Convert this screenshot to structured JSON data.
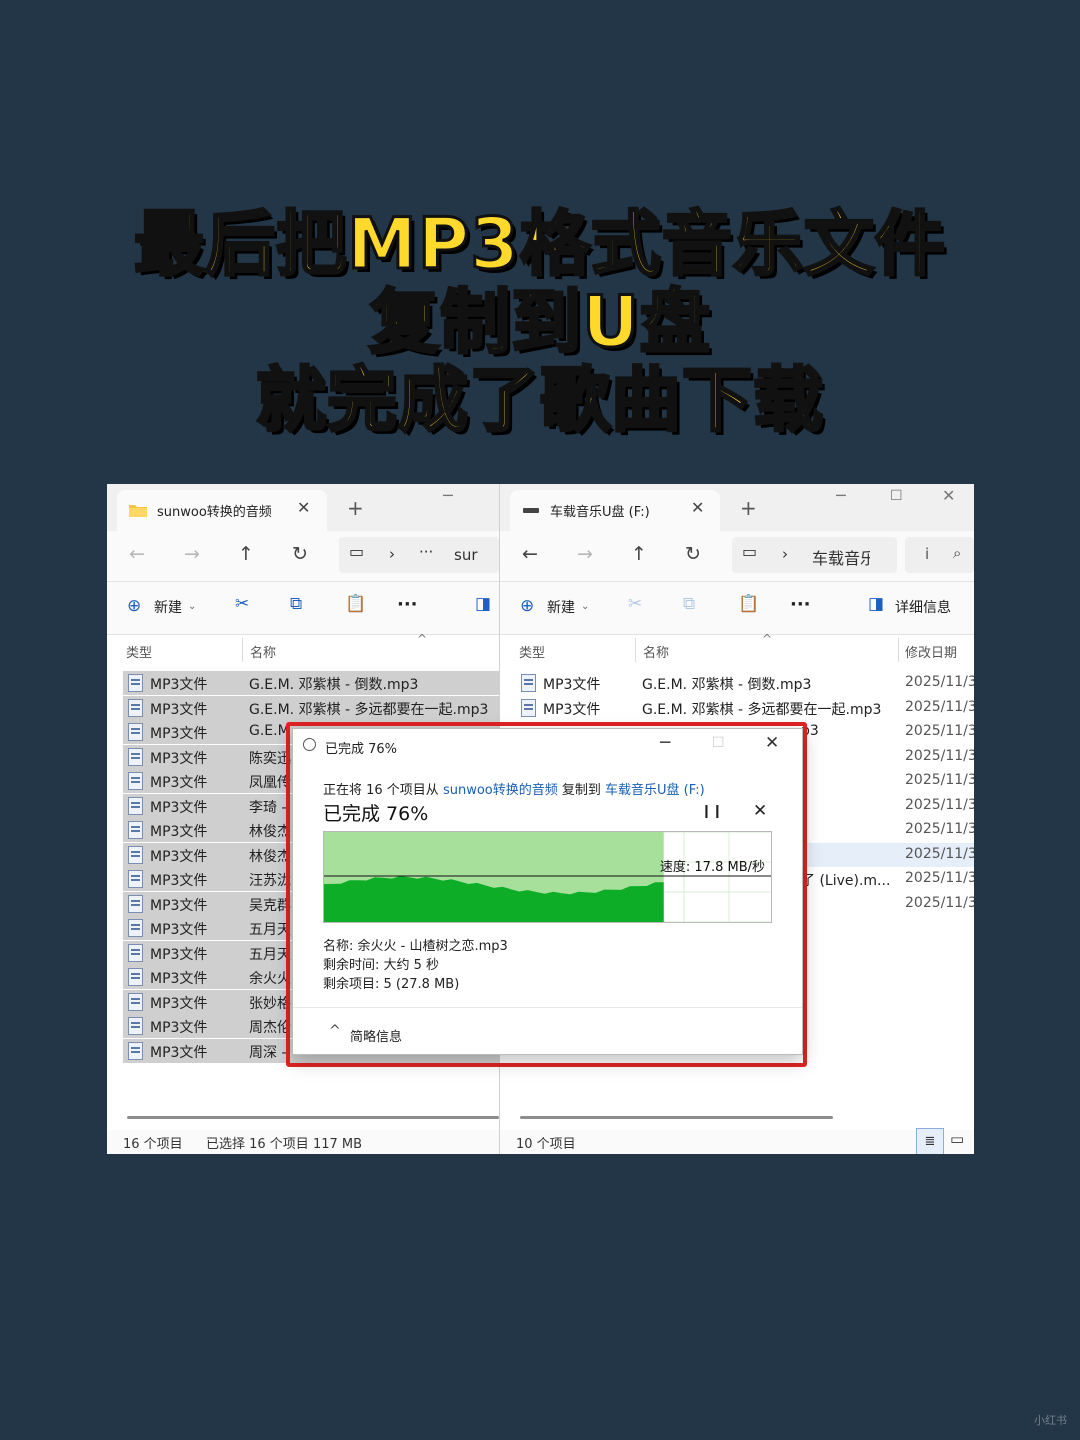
{
  "headline": {
    "line1": "最后把MP3格式音乐文件",
    "line2": "复制到U盘",
    "line3": "就完成了歌曲下载"
  },
  "left_window": {
    "tab_title": "sunwoo转换的音频",
    "address_text": "sur",
    "toolbar_new": "新建",
    "col_type": "类型",
    "col_name": "名称",
    "rows": [
      {
        "type": "MP3文件",
        "name": "G.E.M. 邓紫棋 - 倒数.mp3"
      },
      {
        "type": "MP3文件",
        "name": "G.E.M. 邓紫棋 - 多远都要在一起.mp3"
      },
      {
        "type": "MP3文件",
        "name": "G.E.M"
      },
      {
        "type": "MP3文件",
        "name": "陈奕迅"
      },
      {
        "type": "MP3文件",
        "name": "凤凰传"
      },
      {
        "type": "MP3文件",
        "name": "李琦 -"
      },
      {
        "type": "MP3文件",
        "name": "林俊杰"
      },
      {
        "type": "MP3文件",
        "name": "林俊杰"
      },
      {
        "type": "MP3文件",
        "name": "汪苏泷"
      },
      {
        "type": "MP3文件",
        "name": "吴克群"
      },
      {
        "type": "MP3文件",
        "name": "五月天"
      },
      {
        "type": "MP3文件",
        "name": "五月天"
      },
      {
        "type": "MP3文件",
        "name": "余火火"
      },
      {
        "type": "MP3文件",
        "name": "张妙格"
      },
      {
        "type": "MP3文件",
        "name": "周杰伦"
      },
      {
        "type": "MP3文件",
        "name": "周深 -"
      }
    ],
    "status_count": "16 个项目",
    "status_selected": "已选择 16 个项目  117 MB"
  },
  "right_window": {
    "tab_title": "车载音乐U盘 (F:)",
    "address_text": "车载音乐",
    "toolbar_new": "新建",
    "toolbar_details": "详细信息",
    "col_type": "类型",
    "col_name": "名称",
    "col_date": "修改日期",
    "rows": [
      {
        "type": "MP3文件",
        "name": "G.E.M. 邓紫棋 - 倒数.mp3",
        "date": "2025/11/3"
      },
      {
        "type": "MP3文件",
        "name": "G.E.M. 邓紫棋 - 多远都要在一起.mp3",
        "date": "2025/11/3"
      },
      {
        "type": "",
        "name": "",
        "tail": "p3",
        "date": "2025/11/3"
      },
      {
        "type": "",
        "name": "",
        "tail": "",
        "date": "2025/11/3"
      },
      {
        "type": "",
        "name": "",
        "tail": "",
        "date": "2025/11/3"
      },
      {
        "type": "",
        "name": "",
        "tail": "",
        "date": "2025/11/3"
      },
      {
        "type": "",
        "name": "",
        "tail": "",
        "date": "2025/11/3"
      },
      {
        "type": "",
        "name": "",
        "tail": "",
        "date": "2025/11/3"
      },
      {
        "type": "",
        "name": "",
        "tail": "了 (Live).m...",
        "date": "2025/11/3"
      },
      {
        "type": "",
        "name": "",
        "tail": "",
        "date": "2025/11/3"
      }
    ],
    "status_count": "10 个项目"
  },
  "copy_dialog": {
    "title": "已完成 76%",
    "line_prefix": "正在将 16 个项目从 ",
    "source": "sunwoo转换的音频",
    "line_mid": " 复制到 ",
    "dest": "车载音乐U盘 (F:)",
    "progress_text": "已完成 76%",
    "progress_fraction": 0.76,
    "speed": "速度: 17.8 MB/秒",
    "name_line": "名称: 余火火 - 山楂树之恋.mp3",
    "time_line": "剩余时间: 大约 5 秒",
    "items_line": "剩余项目: 5 (27.8 MB)",
    "brief": "简略信息",
    "colors": {
      "progress_light": "#a6e09a",
      "progress_fill": "#0dad28",
      "highlight": "#e02424"
    }
  },
  "watermark": "小红书"
}
